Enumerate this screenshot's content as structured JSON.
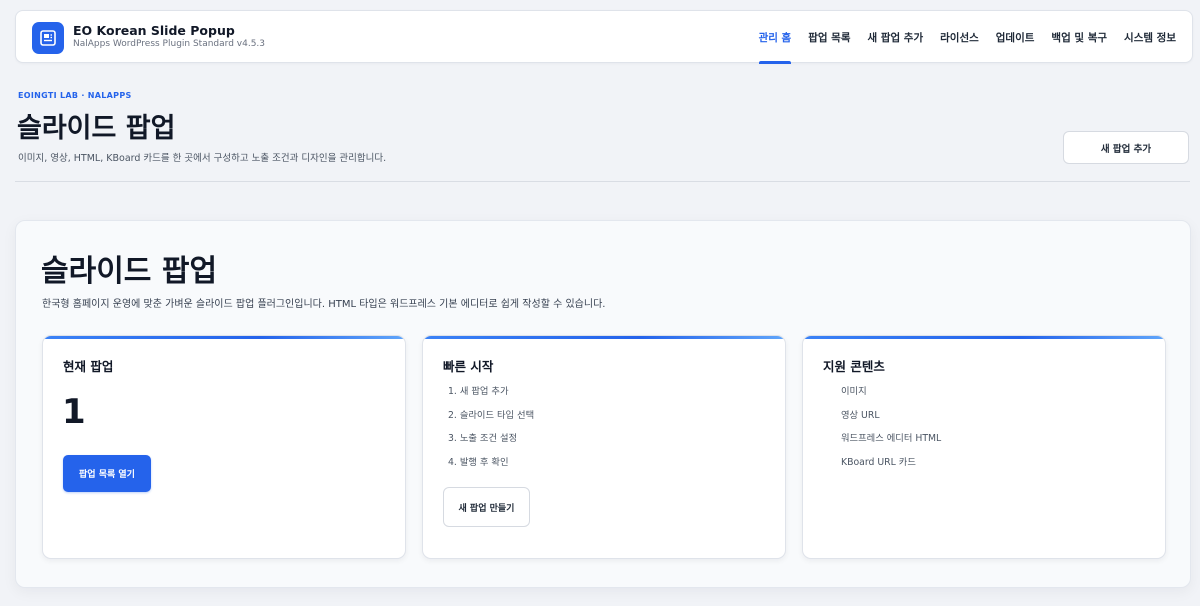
{
  "header": {
    "brand_icon": "popup-slide-icon",
    "title": "EO Korean Slide Popup",
    "subtitle": "NalApps WordPress Plugin Standard v4.5.3",
    "nav": [
      {
        "label": "관리 홈",
        "active": true
      },
      {
        "label": "팝업 목록",
        "active": false
      },
      {
        "label": "새 팝업 추가",
        "active": false
      },
      {
        "label": "라이선스",
        "active": false
      },
      {
        "label": "업데이트",
        "active": false
      },
      {
        "label": "백업 및 복구",
        "active": false
      },
      {
        "label": "시스템 정보",
        "active": false
      }
    ]
  },
  "page": {
    "eyebrow": "EOINGTI LAB · NALAPPS",
    "title": "슬라이드 팝업",
    "description": "이미지, 영상, HTML, KBoard 카드를 한 곳에서 구성하고 노출 조건과 디자인을 관리합니다.",
    "add_button": "새 팝업 추가"
  },
  "panel": {
    "title": "슬라이드 팝업",
    "description": "한국형 홈페이지 운영에 맞춘 가벼운 슬라이드 팝업 플러그인입니다. HTML 타입은 워드프레스 기본 에디터로 쉽게 작성할 수 있습니다.",
    "cards": {
      "current": {
        "title": "현재 팝업",
        "count": "1",
        "button": "팝업 목록 열기"
      },
      "quickstart": {
        "title": "빠른 시작",
        "steps": [
          "1. 새 팝업 추가",
          "2. 슬라이드 타입 선택",
          "3. 노출 조건 설정",
          "4. 발행 후 확인"
        ],
        "button": "새 팝업 만들기"
      },
      "supported": {
        "title": "지원 콘텐츠",
        "items": [
          "이미지",
          "영상 URL",
          "워드프레스 에디터 HTML",
          "KBoard URL 카드"
        ]
      }
    }
  },
  "colors": {
    "accent": "#2563eb",
    "background": "#f1f3f7",
    "text": "#111827"
  }
}
